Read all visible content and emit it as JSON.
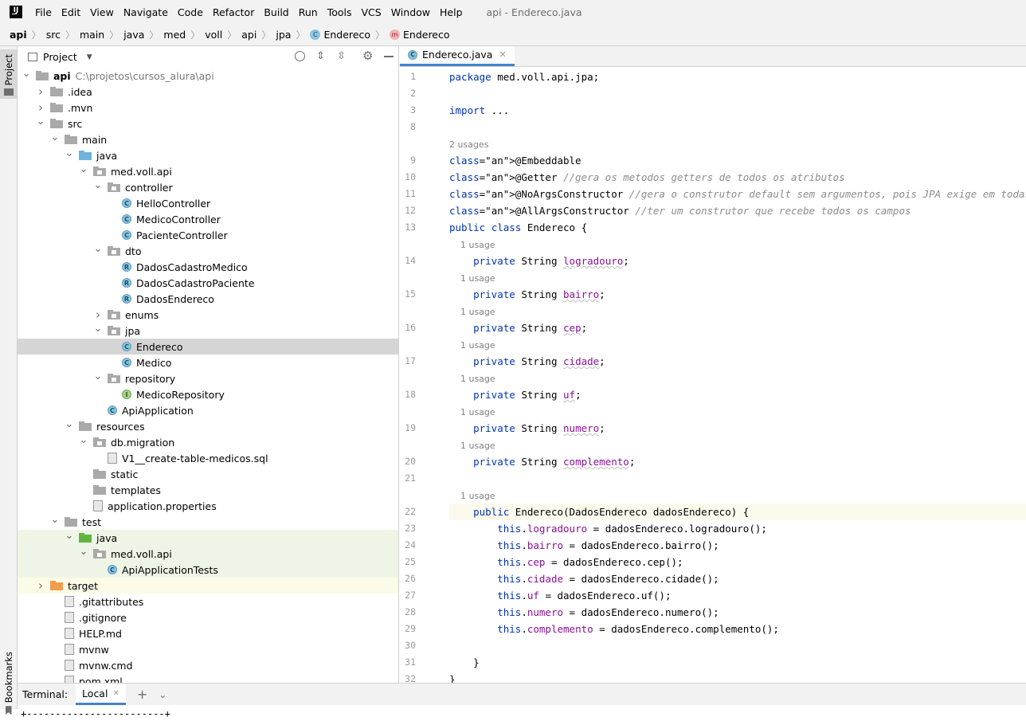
{
  "menu": {
    "items": [
      "File",
      "Edit",
      "View",
      "Navigate",
      "Code",
      "Refactor",
      "Build",
      "Run",
      "Tools",
      "VCS",
      "Window",
      "Help"
    ],
    "window_title": "api - Endereco.java"
  },
  "breadcrumbs": [
    "api",
    "src",
    "main",
    "java",
    "med",
    "voll",
    "api",
    "jpa",
    "Endereco",
    "Endereco"
  ],
  "sidebar": {
    "project_label": "Project",
    "bookmarks_label": "Bookmarks"
  },
  "project_panel": {
    "title": "Project",
    "tree": [
      {
        "label": "api",
        "extra": "C:\\projetos\\cursos_alura\\api",
        "depth": 0,
        "arrow": "down",
        "icon": "folder",
        "bold": true
      },
      {
        "label": ".idea",
        "depth": 1,
        "arrow": "right",
        "icon": "folder"
      },
      {
        "label": ".mvn",
        "depth": 1,
        "arrow": "right",
        "icon": "folder"
      },
      {
        "label": "src",
        "depth": 1,
        "arrow": "down",
        "icon": "folder"
      },
      {
        "label": "main",
        "depth": 2,
        "arrow": "down",
        "icon": "folder"
      },
      {
        "label": "java",
        "depth": 3,
        "arrow": "down",
        "icon": "folder-blue"
      },
      {
        "label": "med.voll.api",
        "depth": 4,
        "arrow": "down",
        "icon": "package"
      },
      {
        "label": "controller",
        "depth": 5,
        "arrow": "down",
        "icon": "package"
      },
      {
        "label": "HelloController",
        "depth": 6,
        "arrow": "none",
        "icon": "class"
      },
      {
        "label": "MedicoController",
        "depth": 6,
        "arrow": "none",
        "icon": "class"
      },
      {
        "label": "PacienteController",
        "depth": 6,
        "arrow": "none",
        "icon": "class"
      },
      {
        "label": "dto",
        "depth": 5,
        "arrow": "down",
        "icon": "package"
      },
      {
        "label": "DadosCadastroMedico",
        "depth": 6,
        "arrow": "none",
        "icon": "record"
      },
      {
        "label": "DadosCadastroPaciente",
        "depth": 6,
        "arrow": "none",
        "icon": "record"
      },
      {
        "label": "DadosEndereco",
        "depth": 6,
        "arrow": "none",
        "icon": "record"
      },
      {
        "label": "enums",
        "depth": 5,
        "arrow": "right",
        "icon": "package"
      },
      {
        "label": "jpa",
        "depth": 5,
        "arrow": "down",
        "icon": "package"
      },
      {
        "label": "Endereco",
        "depth": 6,
        "arrow": "none",
        "icon": "class",
        "selected": true
      },
      {
        "label": "Medico",
        "depth": 6,
        "arrow": "none",
        "icon": "class"
      },
      {
        "label": "repository",
        "depth": 5,
        "arrow": "down",
        "icon": "package"
      },
      {
        "label": "MedicoRepository",
        "depth": 6,
        "arrow": "none",
        "icon": "interface"
      },
      {
        "label": "ApiApplication",
        "depth": 5,
        "arrow": "none",
        "icon": "class"
      },
      {
        "label": "resources",
        "depth": 3,
        "arrow": "down",
        "icon": "folder"
      },
      {
        "label": "db.migration",
        "depth": 4,
        "arrow": "down",
        "icon": "package"
      },
      {
        "label": "V1__create-table-medicos.sql",
        "depth": 5,
        "arrow": "none",
        "icon": "file"
      },
      {
        "label": "static",
        "depth": 4,
        "arrow": "none",
        "icon": "folder"
      },
      {
        "label": "templates",
        "depth": 4,
        "arrow": "none",
        "icon": "folder"
      },
      {
        "label": "application.properties",
        "depth": 4,
        "arrow": "none",
        "icon": "file"
      },
      {
        "label": "test",
        "depth": 2,
        "arrow": "down",
        "icon": "folder"
      },
      {
        "label": "java",
        "depth": 3,
        "arrow": "down",
        "icon": "folder-green",
        "bg": "green"
      },
      {
        "label": "med.voll.api",
        "depth": 4,
        "arrow": "down",
        "icon": "package",
        "bg": "green"
      },
      {
        "label": "ApiApplicationTests",
        "depth": 5,
        "arrow": "none",
        "icon": "class",
        "bg": "green"
      },
      {
        "label": "target",
        "depth": 1,
        "arrow": "right",
        "icon": "folder-orange",
        "bg": "yellow"
      },
      {
        "label": ".gitattributes",
        "depth": 2,
        "arrow": "none",
        "icon": "file"
      },
      {
        "label": ".gitignore",
        "depth": 2,
        "arrow": "none",
        "icon": "file"
      },
      {
        "label": "HELP.md",
        "depth": 2,
        "arrow": "none",
        "icon": "file"
      },
      {
        "label": "mvnw",
        "depth": 2,
        "arrow": "none",
        "icon": "file"
      },
      {
        "label": "mvnw.cmd",
        "depth": 2,
        "arrow": "none",
        "icon": "file"
      },
      {
        "label": "pom.xml",
        "depth": 2,
        "arrow": "none",
        "icon": "file"
      }
    ]
  },
  "editor": {
    "tab_label": "Endereco.java",
    "lines": [
      {
        "n": "1",
        "t": "package med.voll.api.jpa;"
      },
      {
        "n": "2",
        "t": ""
      },
      {
        "n": "3",
        "t": "import ..."
      },
      {
        "n": "8",
        "t": ""
      },
      {
        "hint": "2 usages"
      },
      {
        "n": "9",
        "t": "@Embeddable"
      },
      {
        "n": "10",
        "t": "@Getter //gera os metodos getters de todos os atributos"
      },
      {
        "n": "11",
        "t": "@NoArgsConstructor //gera o construtor default sem argumentos, pois JPA exige em todas as entity"
      },
      {
        "n": "12",
        "t": "@AllArgsConstructor //ter um construtor que recebe todos os campos"
      },
      {
        "n": "13",
        "t": "public class Endereco {"
      },
      {
        "hint": "    1 usage"
      },
      {
        "n": "14",
        "t": "    private String logradouro;"
      },
      {
        "hint": "    1 usage"
      },
      {
        "n": "15",
        "t": "    private String bairro;"
      },
      {
        "hint": "    1 usage"
      },
      {
        "n": "16",
        "t": "    private String cep;"
      },
      {
        "hint": "    1 usage"
      },
      {
        "n": "17",
        "t": "    private String cidade;"
      },
      {
        "hint": "    1 usage"
      },
      {
        "n": "18",
        "t": "    private String uf;"
      },
      {
        "hint": "    1 usage"
      },
      {
        "n": "19",
        "t": "    private String numero;"
      },
      {
        "hint": "    1 usage"
      },
      {
        "n": "20",
        "t": "    private String complemento;"
      },
      {
        "n": "21",
        "t": ""
      },
      {
        "hint": "    1 usage"
      },
      {
        "n": "22",
        "t": "    public Endereco(DadosEndereco dadosEndereco) {",
        "cur": true
      },
      {
        "n": "23",
        "t": "        this.logradouro = dadosEndereco.logradouro();"
      },
      {
        "n": "24",
        "t": "        this.bairro = dadosEndereco.bairro();"
      },
      {
        "n": "25",
        "t": "        this.cep = dadosEndereco.cep();"
      },
      {
        "n": "26",
        "t": "        this.cidade = dadosEndereco.cidade();"
      },
      {
        "n": "27",
        "t": "        this.uf = dadosEndereco.uf();"
      },
      {
        "n": "28",
        "t": "        this.numero = dadosEndereco.numero();"
      },
      {
        "n": "29",
        "t": "        this.complemento = dadosEndereco.complemento();"
      },
      {
        "n": "30",
        "t": ""
      },
      {
        "n": "31",
        "t": "    }"
      },
      {
        "n": "32",
        "t": "}"
      }
    ]
  },
  "terminal": {
    "label": "Terminal:",
    "tab": "Local",
    "output": "+------------------------+"
  },
  "colors": {
    "accent": "#4083c9",
    "selection": "#d5d5d5",
    "test_bg": "#eef5e6",
    "excluded_bg": "#fbfbe7"
  }
}
